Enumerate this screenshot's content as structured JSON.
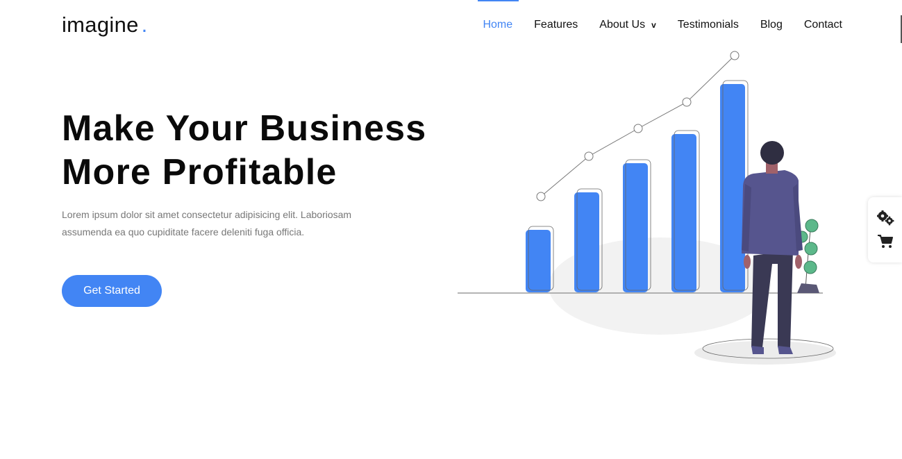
{
  "brand": {
    "name": "imagine",
    "dot": ".",
    "accent": "#4285f4"
  },
  "nav": {
    "items": [
      {
        "label": "Home",
        "active": true
      },
      {
        "label": "Features"
      },
      {
        "label": "About Us",
        "dropdown": "v"
      },
      {
        "label": "Testimonials"
      },
      {
        "label": "Blog"
      },
      {
        "label": "Contact"
      }
    ]
  },
  "hero": {
    "title_line1": "Make Your Business",
    "title_line2": "More Profitable",
    "description": "Lorem ipsum dolor sit amet consectetur adipisicing elit. Laboriosam assumenda ea quo cupiditate facere deleniti fuga officia.",
    "cta_label": "Get Started"
  },
  "illustration": {
    "bar_color": "#4285f4",
    "bar_levels": [
      0.3,
      0.48,
      0.62,
      0.76,
      1.0
    ]
  },
  "side_panel": {
    "icons": [
      "gears-icon",
      "shopping-cart-icon"
    ]
  }
}
